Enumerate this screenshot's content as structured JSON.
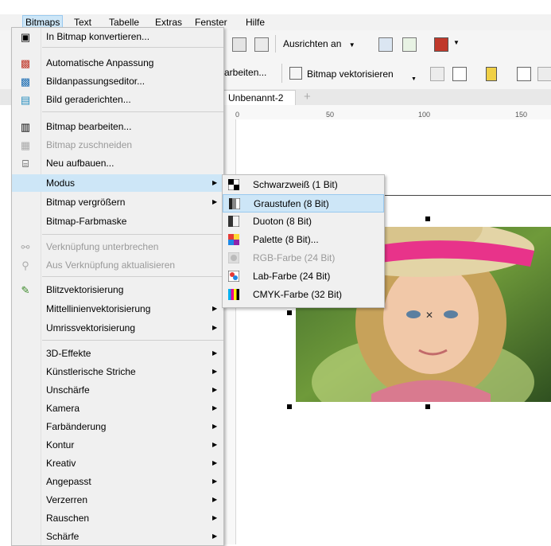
{
  "menubar": {
    "items": [
      "Bitmaps",
      "Text",
      "Tabelle",
      "Extras",
      "Fenster",
      "Hilfe"
    ],
    "active": "Bitmaps"
  },
  "toolbar1": {
    "align_label": "Ausrichten an"
  },
  "toolbar2": {
    "edit_partial": "arbeiten...",
    "vectorize_label": "Bitmap vektorisieren"
  },
  "document": {
    "tab_title": "Unbenannt-2",
    "ruler_ticks": [
      "0",
      "50",
      "100",
      "150"
    ]
  },
  "menu": {
    "items": [
      {
        "label": "In Bitmap konvertieren...",
        "icon": "convert-to-bitmap-icon",
        "enabled": true
      },
      {
        "label": "Automatische Anpassung",
        "icon": "auto-adjust-icon",
        "enabled": true
      },
      {
        "label": "Bildanpassungseditor...",
        "icon": "image-adjustment-lab-icon",
        "enabled": true
      },
      {
        "label": "Bild geraderichten...",
        "icon": "straighten-image-icon",
        "enabled": true
      },
      {
        "label": "Bitmap bearbeiten...",
        "icon": "edit-bitmap-icon",
        "enabled": true
      },
      {
        "label": "Bitmap zuschneiden",
        "icon": "crop-bitmap-icon",
        "enabled": false
      },
      {
        "label": "Neu aufbauen...",
        "icon": "resample-icon",
        "enabled": true
      },
      {
        "label": "Modus",
        "icon": "",
        "enabled": true,
        "submenu": true,
        "highlighted": true
      },
      {
        "label": "Bitmap vergrößern",
        "icon": "",
        "enabled": true,
        "submenu": true
      },
      {
        "label": "Bitmap-Farbmaske",
        "icon": "",
        "enabled": true
      },
      {
        "label": "Verknüpfung unterbrechen",
        "icon": "break-link-icon",
        "enabled": false
      },
      {
        "label": "Aus Verknüpfung aktualisieren",
        "icon": "update-link-icon",
        "enabled": false
      },
      {
        "label": "Blitzvektorisierung",
        "icon": "quick-trace-icon",
        "enabled": true
      },
      {
        "label": "Mittellinienvektorisierung",
        "icon": "",
        "enabled": true,
        "submenu": true
      },
      {
        "label": "Umrissvektorisierung",
        "icon": "",
        "enabled": true,
        "submenu": true
      },
      {
        "label": "3D-Effekte",
        "icon": "",
        "enabled": true,
        "submenu": true
      },
      {
        "label": "Künstlerische Striche",
        "icon": "",
        "enabled": true,
        "submenu": true
      },
      {
        "label": "Unschärfe",
        "icon": "",
        "enabled": true,
        "submenu": true
      },
      {
        "label": "Kamera",
        "icon": "",
        "enabled": true,
        "submenu": true
      },
      {
        "label": "Farbänderung",
        "icon": "",
        "enabled": true,
        "submenu": true
      },
      {
        "label": "Kontur",
        "icon": "",
        "enabled": true,
        "submenu": true
      },
      {
        "label": "Kreativ",
        "icon": "",
        "enabled": true,
        "submenu": true
      },
      {
        "label": "Angepasst",
        "icon": "",
        "enabled": true,
        "submenu": true
      },
      {
        "label": "Verzerren",
        "icon": "",
        "enabled": true,
        "submenu": true
      },
      {
        "label": "Rauschen",
        "icon": "",
        "enabled": true,
        "submenu": true
      },
      {
        "label": "Schärfe",
        "icon": "",
        "enabled": true,
        "submenu": true
      }
    ]
  },
  "submenu": {
    "items": [
      {
        "label": "Schwarzweiß (1 Bit)",
        "icon": "black-white-icon",
        "enabled": true
      },
      {
        "label": "Graustufen (8 Bit)",
        "icon": "grayscale-icon",
        "enabled": true,
        "highlighted": true
      },
      {
        "label": "Duoton (8 Bit)",
        "icon": "duotone-icon",
        "enabled": true
      },
      {
        "label": "Palette (8 Bit)...",
        "icon": "palette-icon",
        "enabled": true
      },
      {
        "label": "RGB-Farbe (24 Bit)",
        "icon": "rgb-icon",
        "enabled": false
      },
      {
        "label": "Lab-Farbe (24 Bit)",
        "icon": "lab-icon",
        "enabled": true
      },
      {
        "label": "CMYK-Farbe (32 Bit)",
        "icon": "cmyk-icon",
        "enabled": true
      }
    ]
  },
  "colors": {
    "highlight": "#cde6f7",
    "highlight_border": "#99c9ef",
    "menu_bg": "#f0f0f0"
  }
}
